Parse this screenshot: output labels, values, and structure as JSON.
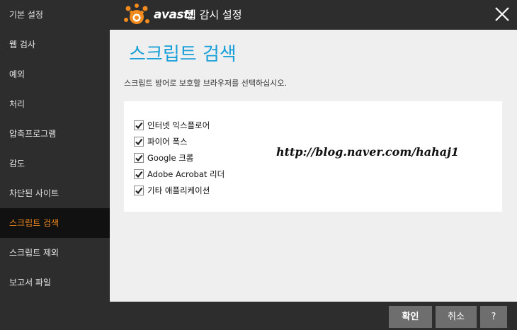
{
  "app": {
    "logo_text": "avast!",
    "title": "웹 감시 설정"
  },
  "sidebar": {
    "items": [
      {
        "label": "기본 설정"
      },
      {
        "label": "웹 검사"
      },
      {
        "label": "예외"
      },
      {
        "label": "처리"
      },
      {
        "label": "압축프로그램"
      },
      {
        "label": "감도"
      },
      {
        "label": "차단된 사이트"
      },
      {
        "label": "스크립트 검색"
      },
      {
        "label": "스크립트 제외"
      },
      {
        "label": "보고서 파일"
      }
    ],
    "active_item": "스크립트 검색"
  },
  "main": {
    "title": "스크립트 검색",
    "description": "스크립트 방어로 보호할 브라우저를 선택하십시오.",
    "browsers": [
      {
        "label": "인터넷 익스플로어",
        "checked": true
      },
      {
        "label": "파이어 폭스",
        "checked": true
      },
      {
        "label": "Google 크롬",
        "checked": true
      },
      {
        "label": "Adobe Acrobat 리더",
        "checked": true
      },
      {
        "label": "기타 애플리케이션",
        "checked": true
      }
    ],
    "watermark": "http://blog.naver.com/hahaj1"
  },
  "footer": {
    "ok_label": "확인",
    "cancel_label": "취소",
    "help_label": "?"
  },
  "colors": {
    "accent_orange": "#f28a1e",
    "title_blue": "#1aa0d8",
    "dark_bg": "#2d2d2d",
    "content_bg": "#efefef"
  }
}
